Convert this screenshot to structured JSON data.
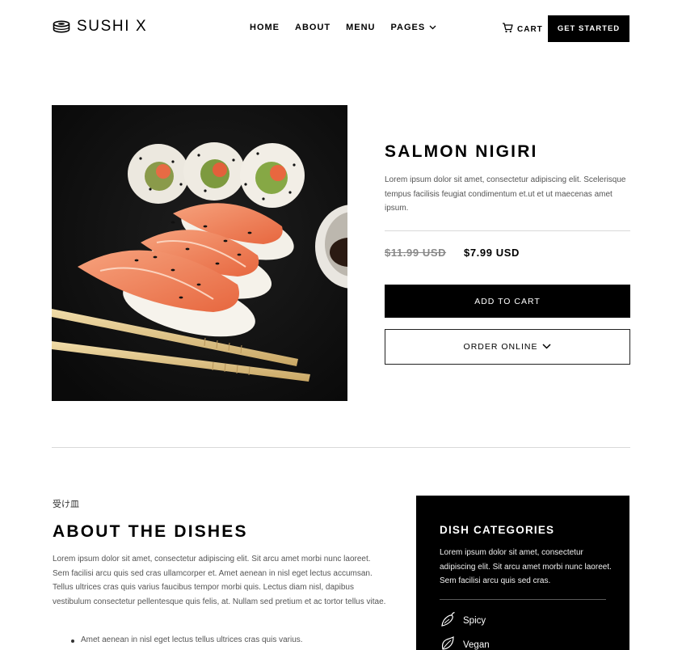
{
  "header": {
    "brand": "SUSHI X",
    "nav": [
      {
        "label": "HOME"
      },
      {
        "label": "ABOUT"
      },
      {
        "label": "MENU"
      },
      {
        "label": "PAGES"
      }
    ],
    "cart_label": "CART",
    "cta_label": "GET STARTED"
  },
  "product": {
    "title": "SALMON NIGIRI",
    "description": "Lorem ipsum dolor sit amet, consectetur adipiscing elit. Scelerisque tempus facilisis feugiat condimentum et.ut et ut maecenas amet ipsum.",
    "price_old": "$11.99 USD",
    "price_new": "$7.99 USD",
    "add_to_cart_label": "ADD TO CART",
    "order_online_label": "ORDER ONLINE"
  },
  "about": {
    "jp_label": "受け皿",
    "title": "ABOUT THE DISHES",
    "text": "Lorem ipsum dolor sit amet, consectetur adipiscing elit. Sit arcu amet morbi nunc laoreet. Sem facilisi arcu quis sed cras ullamcorper et. Amet aenean in nisl eget lectus accumsan. Tellus ultrices cras quis varius faucibus tempor morbi quis. Lectus diam nisl, dapibus vestibulum consectetur pellentesque quis felis, at. Nullam sed pretium et ac tortor tellus vitae.",
    "bullets": [
      "Amet aenean in nisl eget lectus tellus ultrices cras quis varius."
    ]
  },
  "categories": {
    "title": "DISH CATEGORIES",
    "text": "Lorem ipsum dolor sit amet, consectetur adipiscing elit. Sit arcu amet morbi nunc laoreet. Sem facilisi arcu quis sed cras.",
    "items": [
      {
        "label": "Spicy",
        "icon": "chili-icon"
      },
      {
        "label": "Vegan",
        "icon": "leaf-icon"
      }
    ]
  },
  "colors": {
    "primary": "#000000",
    "background": "#ffffff",
    "muted_text": "#555555",
    "divider": "#d9d9d9"
  }
}
